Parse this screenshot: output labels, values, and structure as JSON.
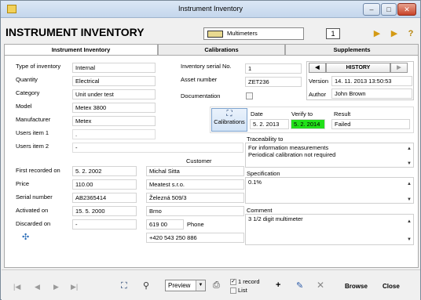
{
  "window": {
    "title": "Instrument Inventory",
    "minimize": "–",
    "maximize": "□",
    "close": "✕"
  },
  "header": {
    "title": "INSTRUMENT INVENTORY",
    "combo_value": "Multimeters",
    "badge": "1",
    "help": "?"
  },
  "tabs": [
    "Instrument Inventory",
    "Calibrations",
    "Supplements"
  ],
  "left": {
    "type_label": "Type of inventory",
    "type_value": "Internal",
    "quantity_label": "Quantity",
    "quantity_value": "Electrical",
    "category_label": "Category",
    "category_value": "Unit under test",
    "model_label": "Model",
    "model_value": "Metex 3800",
    "manufacturer_label": "Manufacturer",
    "manufacturer_value": "Metex",
    "users1_label": "Users item 1",
    "users1_value": ".",
    "users2_label": "Users item 2",
    "users2_value": "-",
    "first_label": "First recorded on",
    "first_value": "5. 2. 2002",
    "price_label": "Price",
    "price_value": "110.00",
    "serial_label": "Serial number",
    "serial_value": "AB2365414",
    "activated_label": "Activated on",
    "activated_value": "15. 5. 2000",
    "discarded_label": "Discarded on",
    "discarded_value": "-"
  },
  "middle": {
    "inv_serial_label": "Inventory serial No.",
    "inv_serial_value": "1",
    "asset_label": "Asset number",
    "asset_value": "ZET236",
    "doc_label": "Documentation",
    "customer_label": "Customer",
    "customer_name": "Michal Sitta",
    "customer_company": "Meatest s.r.o.",
    "customer_street": "Železná 509/3",
    "customer_city": "Brno",
    "customer_zip": "619 00",
    "phone_label": "Phone",
    "customer_phone": "+420 543 250 886"
  },
  "history": {
    "label": "HISTORY",
    "prev": "◀",
    "next": "▶",
    "version_label": "Version",
    "version_value": "14. 11. 2013 13:50:53",
    "author_label": "Author",
    "author_value": "John Brown"
  },
  "calibration": {
    "button_label": "Calibrations",
    "date_label": "Date",
    "date_value": "5. 2. 2013",
    "verify_label": "Verify to",
    "verify_value": "5. 2. 2014",
    "verify_color": "#22e01a",
    "result_label": "Result",
    "result_value": "Failed"
  },
  "traceability": {
    "label": "Traceability to",
    "line1": "For information measurements",
    "line2": "Periodical calibration not required"
  },
  "specification": {
    "label": "Specification",
    "value": "0.1%"
  },
  "comment": {
    "label": "Comment",
    "value": "3 1/2 digit multimeter"
  },
  "footer": {
    "preview_value": "Preview",
    "one_record": "1 record",
    "list": "List",
    "browse": "Browse",
    "close": "Close",
    "nav_first": "|◀",
    "nav_prev": "◀",
    "nav_next": "▶",
    "nav_last": "▶|"
  }
}
